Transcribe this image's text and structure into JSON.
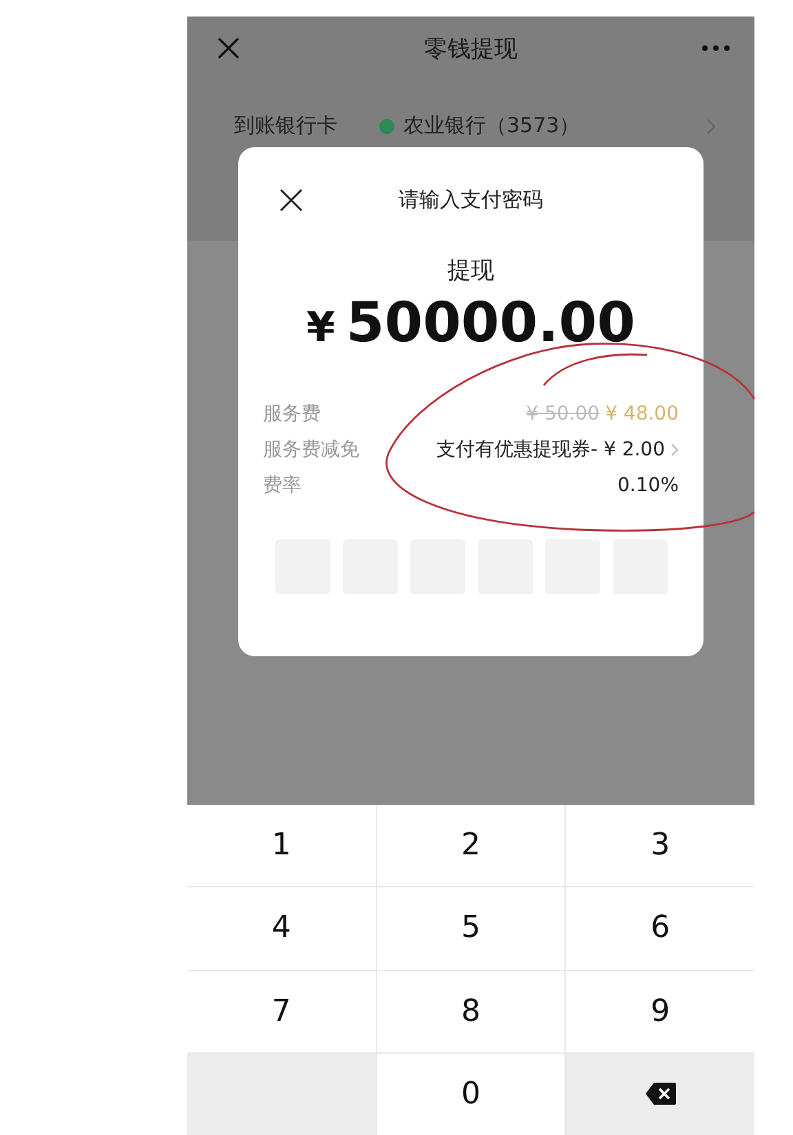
{
  "header": {
    "title": "零钱提现"
  },
  "bank_row": {
    "label": "到账银行卡",
    "bank": "农业银行（3573）"
  },
  "dialog": {
    "title": "请输入支付密码",
    "subtitle": "提现",
    "currency": "¥",
    "amount": "50000.00",
    "fees": [
      {
        "kind": "price",
        "label": "服务费",
        "original": "¥ 50.00",
        "value": "¥ 48.00"
      },
      {
        "kind": "link",
        "label": "服务费减免",
        "value": "支付有优惠提现券- ¥ 2.00"
      },
      {
        "kind": "plain",
        "label": "费率",
        "value": "0.10%"
      }
    ],
    "pin": [
      {
        "filled": false
      },
      {
        "filled": false
      },
      {
        "filled": false
      },
      {
        "filled": false
      },
      {
        "filled": false
      },
      {
        "filled": false
      }
    ]
  },
  "keys": [
    {
      "kind": "digit",
      "label": "1"
    },
    {
      "kind": "digit",
      "label": "2"
    },
    {
      "kind": "digit",
      "label": "3"
    },
    {
      "kind": "digit",
      "label": "4"
    },
    {
      "kind": "digit",
      "label": "5"
    },
    {
      "kind": "digit",
      "label": "6"
    },
    {
      "kind": "digit",
      "label": "7"
    },
    {
      "kind": "digit",
      "label": "8"
    },
    {
      "kind": "digit",
      "label": "9"
    },
    {
      "kind": "blank"
    },
    {
      "kind": "digit",
      "label": "0"
    },
    {
      "kind": "delete"
    }
  ]
}
